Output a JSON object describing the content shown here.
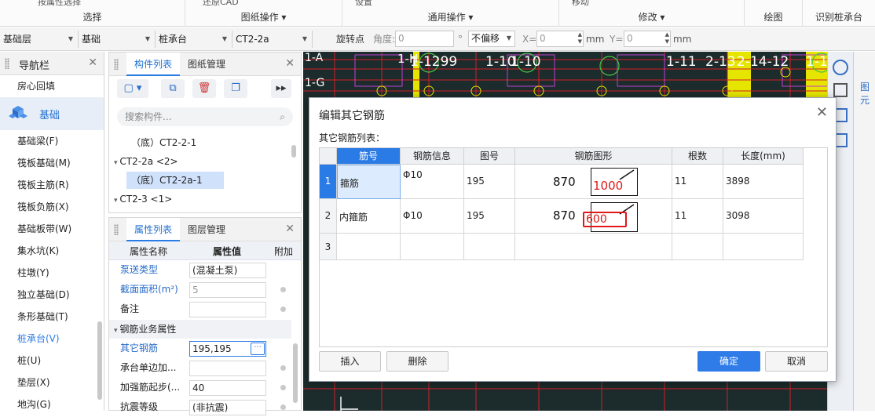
{
  "ribbon": {
    "groups": [
      {
        "label": "选择",
        "top_text": "按属性选择"
      },
      {
        "label": "图纸操作 ▾",
        "top_text": "还原CAD"
      },
      {
        "label": "通用操作 ▾",
        "top_text": "设置"
      },
      {
        "label": "修改 ▾",
        "top_text": "移动"
      },
      {
        "label": "绘图",
        "top_text": ""
      },
      {
        "label": "识别桩承台",
        "top_text": ""
      }
    ]
  },
  "toolbar": {
    "floor": "基础层",
    "category": "基础",
    "type": "桩承台",
    "element": "CT2-2a",
    "rotate_label": "旋转点",
    "angle_label": "角度:",
    "angle_value": "0",
    "degree": "°",
    "offset_mode": "不偏移",
    "x_label": "X=",
    "x_value": "0",
    "y_label": "Y=",
    "y_value": "0",
    "unit": "mm"
  },
  "nav": {
    "title": "导航栏",
    "items": [
      "房心回填",
      "基础",
      "基础梁(F)",
      "筏板基础(M)",
      "筏板主筋(R)",
      "筏板负筋(X)",
      "基础板带(W)",
      "集水坑(K)",
      "柱墩(Y)",
      "独立基础(D)",
      "条形基础(T)",
      "桩承台(V)",
      "桩(U)",
      "垫层(X)",
      "地沟(G)"
    ],
    "active_item": "桩承台(V)"
  },
  "component_panel": {
    "tabs": [
      "构件列表",
      "图纸管理"
    ],
    "search_placeholder": "搜索构件...",
    "tree": [
      "（底）CT2-2-1",
      "CT2-2a <2>",
      "（底）CT2-2a-1",
      "CT2-3 <1>"
    ]
  },
  "property_panel": {
    "tabs": [
      "属性列表",
      "图层管理"
    ],
    "headers": [
      "属性名称",
      "属性值",
      "附加"
    ],
    "rows": [
      {
        "name": "泵送类型",
        "value": "(混凝土泵)"
      },
      {
        "name": "截面面积(m²)",
        "value": "5"
      },
      {
        "name": "备注",
        "value": ""
      }
    ],
    "section": "钢筋业务属性",
    "rows2": [
      {
        "name": "其它钢筋",
        "value": "195,195"
      },
      {
        "name": "承台单边加...",
        "value": ""
      },
      {
        "name": "加强筋起步(...",
        "value": "40"
      },
      {
        "name": "抗震等级",
        "value": "(非抗震)"
      }
    ]
  },
  "canvas": {
    "labels": [
      "1-A",
      "1-H",
      "1-G",
      "1-1299",
      "1-10",
      "1-10",
      "1-11",
      "2-13",
      "2-14-12",
      "1-1"
    ]
  },
  "dialog": {
    "title": "编辑其它钢筋",
    "subtitle": "其它钢筋列表：",
    "columns": [
      "筋号",
      "钢筋信息",
      "图号",
      "钢筋图形",
      "根数",
      "长度(mm)"
    ],
    "rows": [
      {
        "no": "1",
        "name": "箍筋",
        "info": "Φ10",
        "fig": "195",
        "dim1": "870",
        "dim2": "1000",
        "count": "11",
        "length": "3898"
      },
      {
        "no": "2",
        "name": "内箍筋",
        "info": "Φ10",
        "fig": "195",
        "dim1": "870",
        "dim2": "600",
        "count": "11",
        "length": "3098"
      },
      {
        "no": "3",
        "name": "",
        "info": "",
        "fig": "",
        "dim1": "",
        "dim2": "",
        "count": "",
        "length": ""
      }
    ],
    "buttons": {
      "insert": "插入",
      "delete": "删除",
      "ok": "确定",
      "cancel": "取消"
    }
  },
  "right_panel": {
    "label": "图元"
  }
}
